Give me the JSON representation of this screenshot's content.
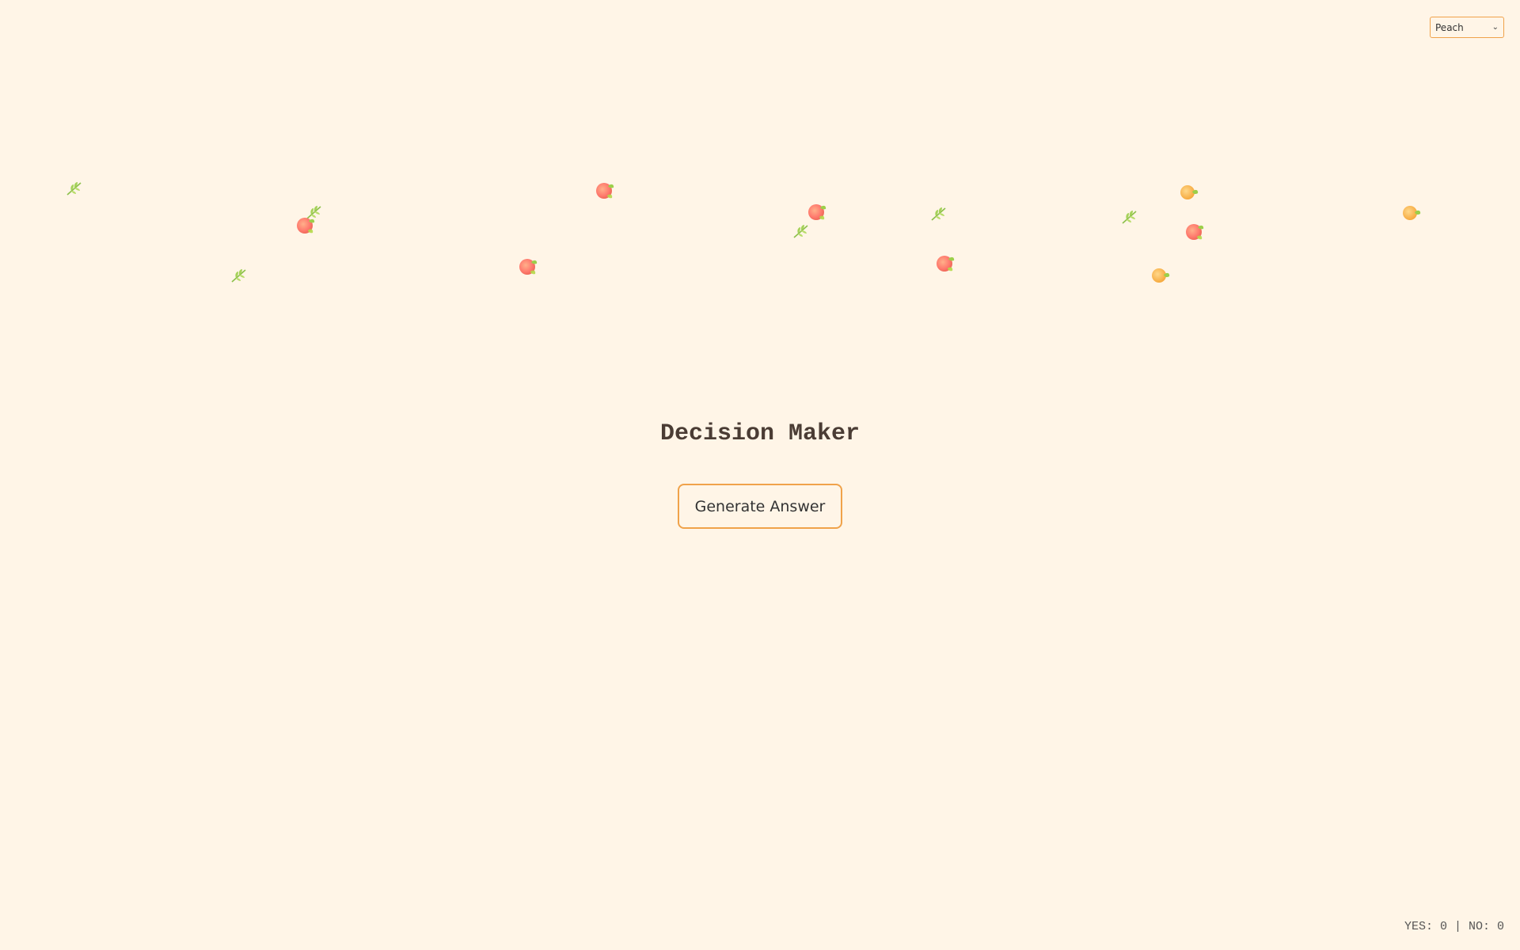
{
  "theme_select": {
    "selected": "Peach"
  },
  "title": "Decision Maker",
  "generate_button": {
    "label": "Generate Answer"
  },
  "counter": {
    "text": "YES: 0 | NO: 0"
  },
  "colors": {
    "background": "#fff5e7",
    "accent": "#f0a24a",
    "text": "#4a3c34"
  },
  "decorations": {
    "icons": [
      "peach-icon",
      "leaf-icon",
      "orange-icon"
    ]
  }
}
